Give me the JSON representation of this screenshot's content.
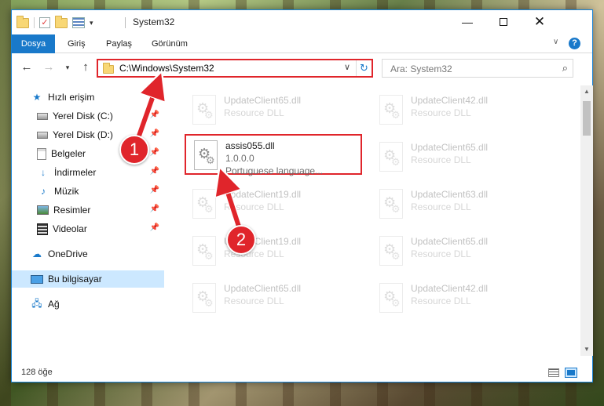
{
  "window": {
    "title": "System32",
    "controls": {
      "minimize": "—",
      "maximize": "",
      "close": "✕"
    }
  },
  "ribbon": {
    "tabs": [
      {
        "label": "Dosya"
      },
      {
        "label": "Giriş"
      },
      {
        "label": "Paylaş"
      },
      {
        "label": "Görünüm"
      }
    ],
    "help": "?"
  },
  "address_bar": {
    "path": "C:\\Windows\\System32"
  },
  "search": {
    "placeholder": "Ara: System32"
  },
  "sidebar": {
    "items": [
      {
        "label": "Hızlı erişim",
        "icon": "star-icon"
      },
      {
        "label": "Yerel Disk (C:)",
        "icon": "drive-icon",
        "pinned": true
      },
      {
        "label": "Yerel Disk (D:)",
        "icon": "drive-icon",
        "pinned": true
      },
      {
        "label": "Belgeler",
        "icon": "document-icon",
        "pinned": true
      },
      {
        "label": "İndirmeler",
        "icon": "download-icon",
        "pinned": true
      },
      {
        "label": "Müzik",
        "icon": "music-icon",
        "pinned": true
      },
      {
        "label": "Resimler",
        "icon": "pictures-icon",
        "pinned": true
      },
      {
        "label": "Videolar",
        "icon": "video-icon",
        "pinned": true
      },
      {
        "label": "OneDrive",
        "icon": "cloud-icon"
      },
      {
        "label": "Bu bilgisayar",
        "icon": "computer-icon",
        "selected": true
      },
      {
        "label": "Ağ",
        "icon": "network-icon"
      }
    ]
  },
  "files": [
    {
      "name": "UpdateClient65.dll",
      "type": "Resource DLL"
    },
    {
      "name": "UpdateClient42.dll",
      "type": "Resource DLL"
    },
    {
      "name": "assis055.dll",
      "version": "1.0.0.0",
      "description": "Portuguese language..."
    },
    {
      "name": "UpdateClient65.dll",
      "type": "Resource DLL"
    },
    {
      "name": "UpdateClient19.dll",
      "type": "Resource DLL"
    },
    {
      "name": "UpdateClient63.dll",
      "type": "Resource DLL"
    },
    {
      "name": "UpdateClient19.dll",
      "type": "Resource DLL"
    },
    {
      "name": "UpdateClient65.dll",
      "type": "Resource DLL"
    },
    {
      "name": "UpdateClient65.dll",
      "type": "Resource DLL"
    },
    {
      "name": "UpdateClient42.dll",
      "type": "Resource DLL"
    }
  ],
  "status": {
    "item_count": "128 öğe"
  },
  "annotations": {
    "step1": "1",
    "step2": "2",
    "color": "#e0252b"
  }
}
